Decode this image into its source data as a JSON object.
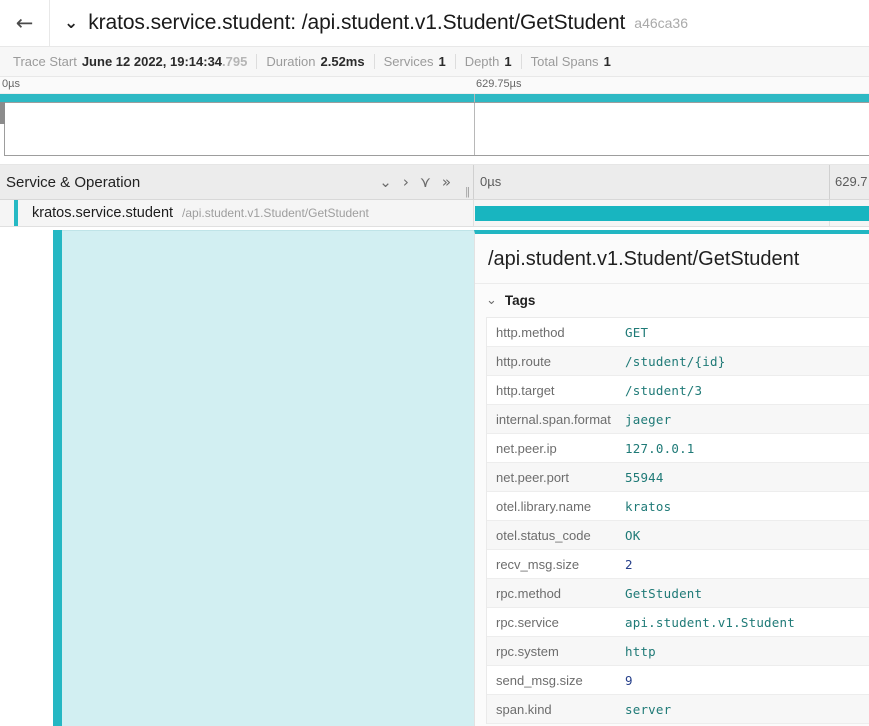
{
  "header": {
    "back_icon": "arrow-left-icon",
    "collapse_icon": "chevron-down-icon",
    "title": "kratos.service.student: /api.student.v1.Student/GetStudent",
    "trace_id": "a46ca36"
  },
  "meta": [
    {
      "label": "Trace Start",
      "value": "June 12 2022, 19:14:34",
      "value_dim": ".795"
    },
    {
      "label": "Duration",
      "value": "2.52ms",
      "value_dim": ""
    },
    {
      "label": "Services",
      "value": "1",
      "value_dim": ""
    },
    {
      "label": "Depth",
      "value": "1",
      "value_dim": ""
    },
    {
      "label": "Total Spans",
      "value": "1",
      "value_dim": ""
    }
  ],
  "minimap": {
    "tick_start": "0µs",
    "tick_mid": "629.75µs"
  },
  "columns": {
    "service_operation_header": "Service & Operation",
    "collapse_one_icon": "chevron-down-icon",
    "expand_one_icon": "chevron-right-icon",
    "collapse_all_icon": "double-chevron-down-icon",
    "expand_all_icon": "double-chevron-right-icon",
    "tick_start": "0µs",
    "tick_mid": "629.7"
  },
  "span": {
    "service": "kratos.service.student",
    "operation": "/api.student.v1.Student/GetStudent"
  },
  "detail": {
    "title": "/api.student.v1.Student/GetStudent",
    "section_label": "Tags",
    "section_chevron_icon": "chevron-down-icon",
    "tags": [
      {
        "key": "http.method",
        "value": "GET",
        "type": "string"
      },
      {
        "key": "http.route",
        "value": "/student/{id}",
        "type": "string"
      },
      {
        "key": "http.target",
        "value": "/student/3",
        "type": "string"
      },
      {
        "key": "internal.span.format",
        "value": "jaeger",
        "type": "string"
      },
      {
        "key": "net.peer.ip",
        "value": "127.0.0.1",
        "type": "string"
      },
      {
        "key": "net.peer.port",
        "value": "55944",
        "type": "string"
      },
      {
        "key": "otel.library.name",
        "value": "kratos",
        "type": "string"
      },
      {
        "key": "otel.status_code",
        "value": "OK",
        "type": "string"
      },
      {
        "key": "recv_msg.size",
        "value": "2",
        "type": "number"
      },
      {
        "key": "rpc.method",
        "value": "GetStudent",
        "type": "string"
      },
      {
        "key": "rpc.service",
        "value": "api.student.v1.Student",
        "type": "string"
      },
      {
        "key": "rpc.system",
        "value": "http",
        "type": "string"
      },
      {
        "key": "send_msg.size",
        "value": "9",
        "type": "number"
      },
      {
        "key": "span.kind",
        "value": "server",
        "type": "string"
      }
    ]
  },
  "colors": {
    "accent_teal": "#21b6c2",
    "bar_teal": "#18b5c0",
    "detail_fill": "#d2eff2",
    "value_teal": "#1f7a77",
    "value_navy": "#27408b"
  }
}
